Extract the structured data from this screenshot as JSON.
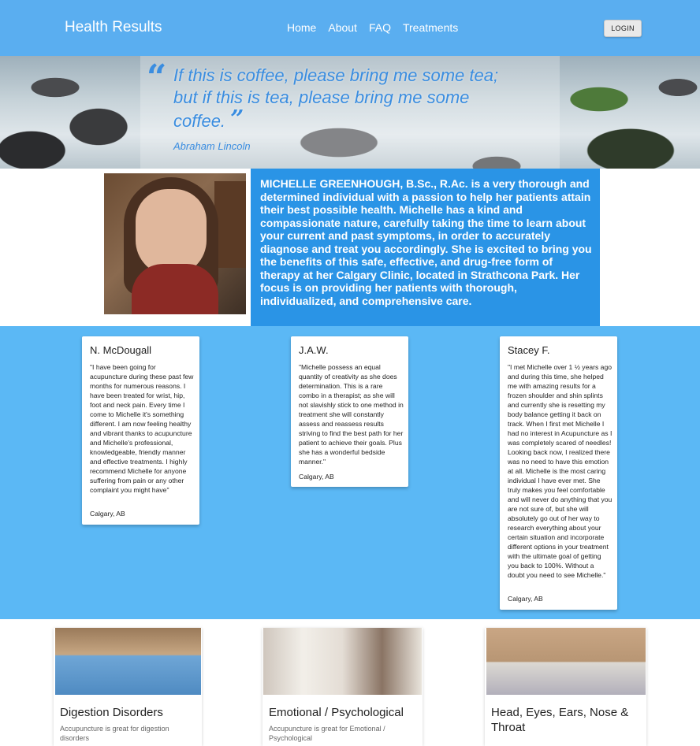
{
  "nav": {
    "brand": "Health Results",
    "links": [
      "Home",
      "About",
      "FAQ",
      "Treatments"
    ],
    "login_label": "LOGIN"
  },
  "hero": {
    "quote": "If this is coffee, please bring me some tea; but if this is tea, please bring me some coffee.",
    "author": "Abraham Lincoln"
  },
  "profile": {
    "bio": "MICHELLE GREENHOUGH, B.Sc., R.Ac. is a very thorough and determined individual with a passion to help her patients attain their best possible health. Michelle has a kind and compassionate nature, carefully taking the time to learn about your current and past symptoms, in order to accurately diagnose and treat you accordingly. She is excited to bring you the benefits of this safe, effective, and drug-free form of therapy at her Calgary Clinic, located in Strathcona Park. Her focus is on providing her patients with thorough, individualized, and comprehensive care."
  },
  "testimonials": [
    {
      "name": "N. McDougall",
      "text": "\"I have been going for acupuncture during these past few months for numerous reasons. I have been treated for wrist, hip, foot and neck pain. Every time I come to Michelle it's something different. I am now feeling healthy and vibrant thanks to acupuncture and Michelle's professional, knowledgeable, friendly manner and effective treatments. I highly recommend Michelle for anyone suffering from pain or any other complaint you might have\"",
      "location": "Calgary, AB"
    },
    {
      "name": "J.A.W.",
      "text": "\"Michelle possess an equal quantity of creativity as she does determination. This is a rare combo in a therapist; as she will not slavishly stick to one method in treatment she will constantly assess and reassess results striving to find the best path for her patient to achieve their goals. Plus she has a wonderful bedside manner.\"",
      "location": "Calgary, AB"
    },
    {
      "name": "Stacey F.",
      "text": "\"I met Michelle over 1 ½ years ago and during this time, she helped me with amazing results for a frozen shoulder and shin splints and currently she is resetting my body balance getting it back on track. When I first met Michelle I had no interest in Acupuncture as I was completely scared of needles! Looking back now, I realized there was no need to have this emotion at all. Michelle is the most caring individual I have ever met. She truly makes you feel comfortable and will never do anything that you are not sure of, but she will absolutely go out of her way to research everything about your certain situation and incorporate different options in your treatment with the ultimate goal of getting you back to 100%. Without a doubt you need to see Michelle.\"",
      "location": "Calgary, AB"
    }
  ],
  "services": [
    {
      "title": "Digestion Disorders",
      "desc": "Accupuncture is great for digestion disorders"
    },
    {
      "title": "Emotional / Psychological",
      "desc": "Accupuncture is great for Emotional / Psychological"
    },
    {
      "title": "Head, Eyes, Ears, Nose & Throat",
      "desc": ""
    }
  ]
}
